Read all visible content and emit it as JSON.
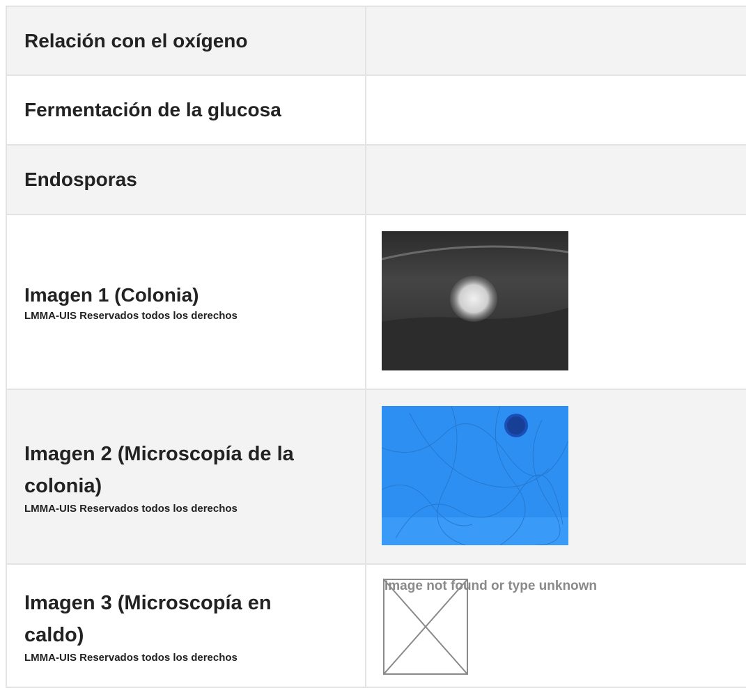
{
  "rows": [
    {
      "label": "Relación con el oxígeno",
      "value": ""
    },
    {
      "label": "Fermentación de la glucosa",
      "value": ""
    },
    {
      "label": "Endosporas",
      "value": ""
    },
    {
      "label": "Imagen 1 (Colonia)",
      "credit": "LMMA-UIS Reservados todos los derechos"
    },
    {
      "label_line1": "Imagen 2 (Microscopía de la",
      "label_line2": "colonia)",
      "credit": "LMMA-UIS Reservados todos los derechos"
    },
    {
      "label_line1": "Imagen 3 (Microscopía en",
      "label_line2": "caldo)",
      "credit": "LMMA-UIS Reservados todos los derechos",
      "broken_image_text": "Image not found or type unknown"
    }
  ],
  "colors": {
    "shaded_row": "#f3f3f3",
    "border": "#e3e3e3",
    "text": "#222222"
  }
}
